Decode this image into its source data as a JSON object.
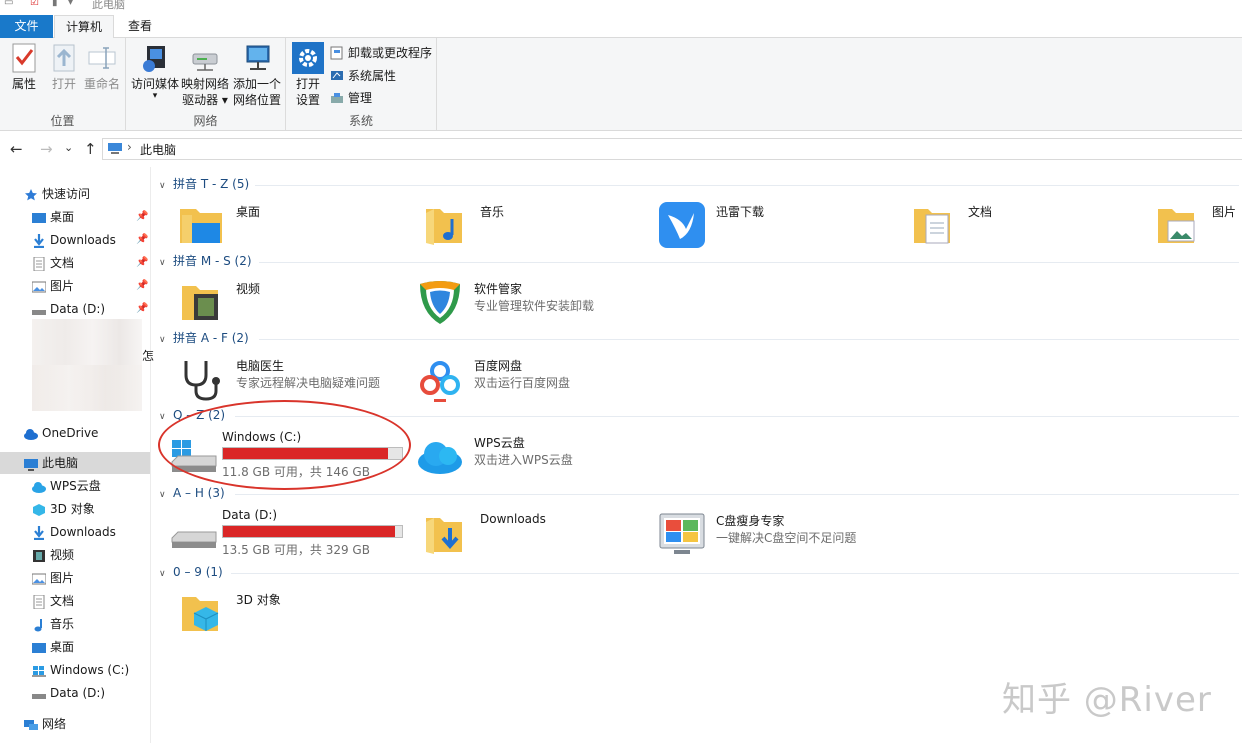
{
  "window": {
    "title": "此电脑"
  },
  "ribbon": {
    "tabs": [
      {
        "label": "文件"
      },
      {
        "label": "计算机"
      },
      {
        "label": "查看"
      }
    ],
    "groups": {
      "location": {
        "name": "位置",
        "buttons": [
          {
            "label": "属性"
          },
          {
            "label": "打开"
          },
          {
            "label": "重命名"
          }
        ]
      },
      "network": {
        "name": "网络",
        "buttons": [
          {
            "label": "访问媒体",
            "line2": "▾"
          },
          {
            "label": "映射网络",
            "line2": "驱动器 ▾"
          },
          {
            "label": "添加一个",
            "line2": "网络位置"
          }
        ]
      },
      "system": {
        "name": "系统",
        "open_settings": {
          "label": "打开",
          "line2": "设置"
        },
        "small": [
          {
            "label": "卸载或更改程序"
          },
          {
            "label": "系统属性"
          },
          {
            "label": "管理"
          }
        ]
      }
    }
  },
  "address": {
    "breadcrumb": "此电脑",
    "separator": "›"
  },
  "nav": {
    "back": "←",
    "forward": "→",
    "recent": "⌄",
    "up": "↑"
  },
  "sidebar": {
    "quick_access": "快速访问",
    "quick_items": [
      {
        "label": "桌面"
      },
      {
        "label": "Downloads"
      },
      {
        "label": "文档"
      },
      {
        "label": "图片"
      },
      {
        "label": "Data (D:)"
      }
    ],
    "partial_text": "怎",
    "onedrive": "OneDrive",
    "this_pc": "此电脑",
    "pc_items": [
      {
        "label": "WPS云盘"
      },
      {
        "label": "3D 对象"
      },
      {
        "label": "Downloads"
      },
      {
        "label": "视频"
      },
      {
        "label": "图片"
      },
      {
        "label": "文档"
      },
      {
        "label": "音乐"
      },
      {
        "label": "桌面"
      },
      {
        "label": "Windows (C:)"
      },
      {
        "label": "Data (D:)"
      }
    ],
    "network": "网络"
  },
  "groups": [
    {
      "header": "拼音 T - Z (5)",
      "items": [
        {
          "name": "桌面"
        },
        {
          "name": "音乐"
        },
        {
          "name": "迅雷下载"
        },
        {
          "name": "文档"
        },
        {
          "name": "图片"
        }
      ]
    },
    {
      "header": "拼音 M - S (2)",
      "items": [
        {
          "name": "视频"
        },
        {
          "name": "软件管家",
          "desc": "专业管理软件安装卸载"
        }
      ]
    },
    {
      "header": "拼音 A - F (2)",
      "items": [
        {
          "name": "电脑医生",
          "desc": "专家远程解决电脑疑难问题"
        },
        {
          "name": "百度网盘",
          "desc": "双击运行百度网盘"
        }
      ]
    },
    {
      "header": "Q – Z (2)",
      "items": [
        {
          "name": "Windows (C:)",
          "desc": "11.8 GB 可用，共 146 GB",
          "used_fraction": 0.92
        },
        {
          "name": "WPS云盘",
          "desc": "双击进入WPS云盘"
        }
      ]
    },
    {
      "header": "A – H (3)",
      "items": [
        {
          "name": "Data (D:)",
          "desc": "13.5 GB 可用，共 329 GB",
          "used_fraction": 0.96
        },
        {
          "name": "Downloads"
        },
        {
          "name": "C盘瘦身专家",
          "desc": "一键解决C盘空间不足问题"
        }
      ]
    },
    {
      "header": "0 – 9 (1)",
      "items": [
        {
          "name": "3D 对象"
        }
      ]
    }
  ],
  "watermark": "知乎 @River",
  "colors": {
    "accent": "#1979ca",
    "drive_bar": "#da2626",
    "annotation": "#d9342b"
  }
}
